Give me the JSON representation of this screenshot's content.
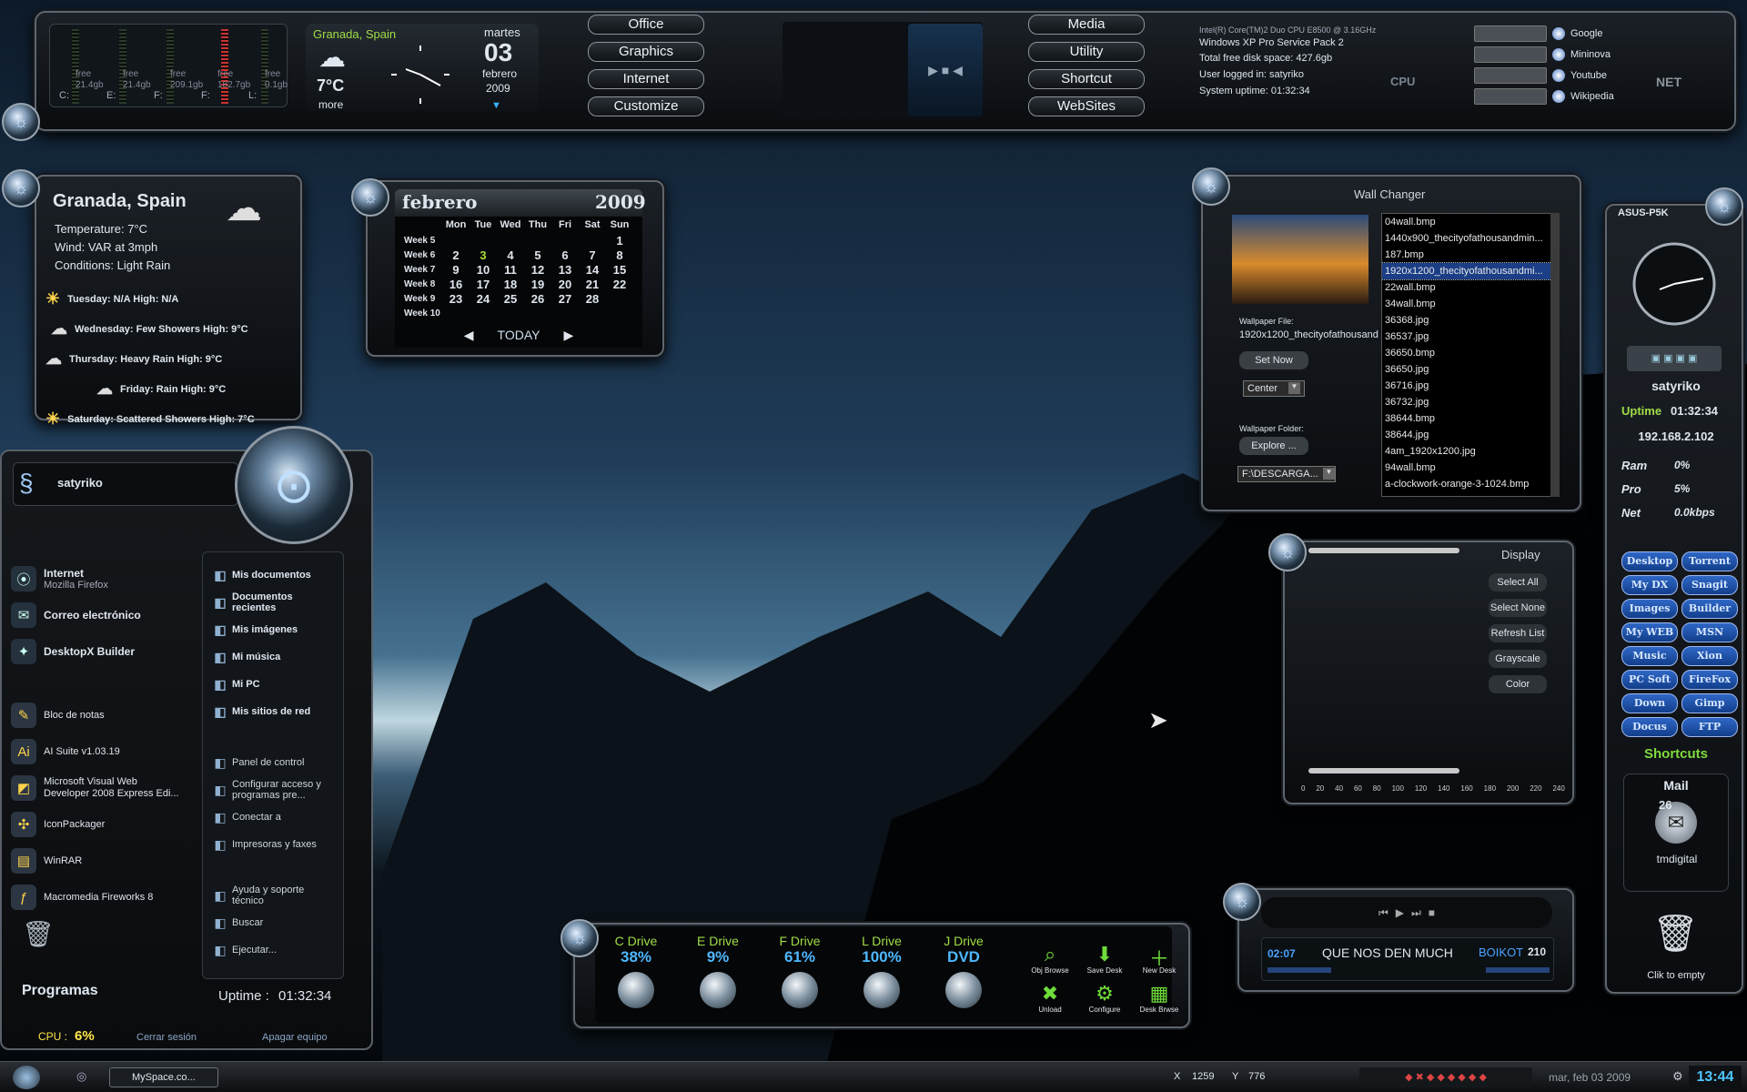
{
  "topbar": {
    "drives": [
      {
        "label": "C:",
        "free": "21.4gb",
        "free_label": "free"
      },
      {
        "label": "E:",
        "free": "21.4gb",
        "free_label": "free"
      },
      {
        "label": "F:",
        "free": "209.1gb",
        "free_label": "free"
      },
      {
        "label": "F:",
        "free": "182.7gb",
        "free_label": "free"
      },
      {
        "label": "L:",
        "free": "0.1gb",
        "free_label": "free"
      }
    ],
    "weather": {
      "city": "Granada, Spain",
      "temp": "7°C",
      "more": "more",
      "weekday": "martes",
      "day": "03",
      "month": "febrero",
      "year": "2009"
    },
    "menu_left": [
      "Office",
      "Graphics",
      "Internet",
      "Customize"
    ],
    "menu_right": [
      "Media",
      "Utility",
      "Shortcut",
      "WebSites"
    ],
    "sysinfo": {
      "cpu": "Intel(R) Core(TM)2 Duo CPU     E8500  @ 3.16GHz",
      "os": "Windows XP Pro Service Pack 2",
      "disk": "Total free disk space: 427.6gb",
      "user": "User logged in: satyriko",
      "uptime": "System uptime: 01:32:34",
      "cpu_label": "CPU"
    },
    "search": {
      "items": [
        "Google",
        "Mininova",
        "Youtube",
        "Wikipedia"
      ],
      "net_label": "NET"
    }
  },
  "weather_widget": {
    "city": "Granada, Spain",
    "temperature": "Temperature: 7°C",
    "wind": "Wind: VAR at 3mph",
    "conditions": "Conditions: Light Rain",
    "forecast": [
      "Tuesday: N/A High: N/A",
      "Wednesday: Few Showers High: 9°C",
      "Thursday: Heavy Rain High: 9°C",
      "Friday: Rain High: 9°C",
      "Saturday: Scattered Showers High: 7°C"
    ]
  },
  "calendar": {
    "month": "febrero",
    "year": "2009",
    "today": "TODAY",
    "headers": [
      "Mon",
      "Tue",
      "Wed",
      "Thu",
      "Fri",
      "Sat",
      "Sun"
    ],
    "weeks": [
      {
        "label": "Week 5",
        "days": [
          "",
          "",
          "",
          "",
          "",
          "",
          "1"
        ]
      },
      {
        "label": "Week 6",
        "days": [
          "2",
          "3",
          "4",
          "5",
          "6",
          "7",
          "8"
        ]
      },
      {
        "label": "Week 7",
        "days": [
          "9",
          "10",
          "11",
          "12",
          "13",
          "14",
          "15"
        ]
      },
      {
        "label": "Week 8",
        "days": [
          "16",
          "17",
          "18",
          "19",
          "20",
          "21",
          "22"
        ]
      },
      {
        "label": "Week 9",
        "days": [
          "23",
          "24",
          "25",
          "26",
          "27",
          "28",
          ""
        ]
      },
      {
        "label": "Week 10",
        "days": [
          "",
          "",
          "",
          "",
          "",
          "",
          ""
        ]
      }
    ]
  },
  "startmenu": {
    "user": "satyriko",
    "pinned": [
      {
        "title": "Internet",
        "sub": "Mozilla Firefox"
      },
      {
        "title": "Correo electrónico",
        "sub": ""
      },
      {
        "title": "DesktopX Builder",
        "sub": ""
      }
    ],
    "recent": [
      "Bloc de notas",
      "AI Suite v1.03.19",
      "Microsoft Visual Web Developer 2008 Express Edi...",
      "IconPackager",
      "WinRAR",
      "Macromedia Fireworks 8"
    ],
    "right_top": [
      "Mis documentos",
      "Documentos recientes",
      "Mis imágenes",
      "Mi música",
      "Mi PC",
      "Mis sitios de red"
    ],
    "right_mid": [
      "Panel de control",
      "Configurar acceso y programas pre...",
      "Conectar a",
      "Impresoras y faxes"
    ],
    "right_bottom": [
      "Ayuda y soporte técnico",
      "Buscar",
      "Ejecutar..."
    ],
    "programs": "Programas",
    "uptime_label": "Uptime :",
    "uptime": "01:32:34",
    "cpu_label": "CPU :",
    "cpu_val": "6%",
    "logoff": "Cerrar sesión",
    "shutdown": "Apagar equipo"
  },
  "wallchanger": {
    "title": "Wall Changer",
    "file_label": "Wallpaper File:",
    "file": "1920x1200_thecityofathousand",
    "set_now": "Set Now",
    "mode": "Center",
    "folder_label": "Wallpaper Folder:",
    "explore": "Explore ...",
    "folder": "F:\\DESCARGA...",
    "files": [
      "04wall.bmp",
      "1440x900_thecityofathousandmin...",
      "187.bmp",
      "1920x1200_thecityofathousandmi...",
      "22wall.bmp",
      "34wall.bmp",
      "36368.jpg",
      "36537.jpg",
      "36650.bmp",
      "36650.jpg",
      "36716.jpg",
      "36732.jpg",
      "38644.bmp",
      "38644.jpg",
      "4am_1920x1200.jpg",
      "94wall.bmp",
      "a-clockwork-orange-3-1024.bmp"
    ],
    "selected_index": 3
  },
  "display": {
    "title": "Display",
    "buttons": [
      "Select All",
      "Select None",
      "Refresh List",
      "Grayscale",
      "Color"
    ],
    "ticks": [
      "0",
      "20",
      "40",
      "60",
      "80",
      "100",
      "120",
      "140",
      "160",
      "180",
      "200",
      "220",
      "240"
    ]
  },
  "sidebar": {
    "board": "ASUS-P5K",
    "user": "satyriko",
    "uptime_label": "Uptime",
    "uptime": "01:32:34",
    "ip": "192.168.2.102",
    "ram_label": "Ram",
    "ram": "0%",
    "pro_label": "Pro",
    "pro": "5%",
    "net_label": "Net",
    "net": "0.0kbps",
    "links": [
      "Desktop",
      "Torrent",
      "My DX",
      "Snagit",
      "Images",
      "Builder",
      "My WEB",
      "MSN",
      "Music",
      "Xion",
      "PC Soft",
      "FireFox",
      "Down",
      "Gimp",
      "Docus",
      "FTP"
    ],
    "shortcuts": "Shortcuts",
    "mail": "Mail",
    "mail_count": "26",
    "mail_account": "tmdigital",
    "recycle": "Clik to empty"
  },
  "drives_widget": {
    "drives": [
      {
        "name": "C Drive",
        "value": "38%"
      },
      {
        "name": "E Drive",
        "value": "9%"
      },
      {
        "name": "F Drive",
        "value": "61%"
      },
      {
        "name": "L Drive",
        "value": "100%"
      },
      {
        "name": "J Drive",
        "value": "DVD"
      }
    ],
    "actions": [
      "Obj Browse",
      "Save Desk",
      "New Desk",
      "Unload",
      "Configure",
      "Desk Brwse"
    ]
  },
  "player": {
    "time": "02:07",
    "title": "QUE NOS DEN MUCH",
    "artist": "BOIKOT",
    "bitrate": "210"
  },
  "taskbar": {
    "task": "MySpace.co...",
    "x_label": "X",
    "x": "1259",
    "y_label": "Y",
    "y": "776",
    "date": "mar, feb 03 2009",
    "time": "13:44"
  },
  "colors": {
    "accent": "#9fdd46",
    "highlight": "#1b3e86"
  }
}
